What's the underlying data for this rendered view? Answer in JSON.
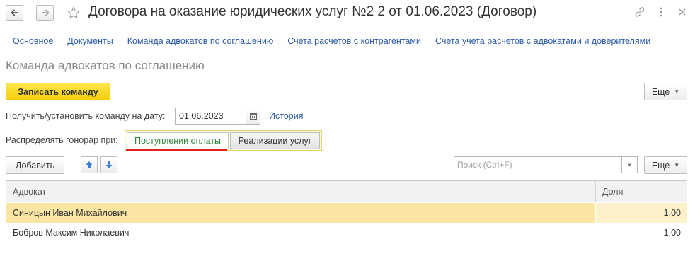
{
  "window": {
    "title": "Договора на оказание юридических услуг №2 2 от 01.06.2023 (Договор)"
  },
  "nav_links": [
    "Основное",
    "Документы",
    "Команда адвокатов по соглашению",
    "Счета расчетов с контрагентами",
    "Счета учета расчетов с адвокатами и доверителями"
  ],
  "section": {
    "title": "Команда адвокатов по соглашению"
  },
  "toolbar": {
    "write_team_label": "Записать команду",
    "more_label": "Еще"
  },
  "date_row": {
    "label": "Получить/установить команду на дату:",
    "value": "01.06.2023",
    "history_link": "История"
  },
  "distribute": {
    "label": "Распределять гонорар при:",
    "option_payment": "Поступлении оплаты",
    "option_sale": "Реализации услуг",
    "selected": "Поступлении оплаты"
  },
  "table_toolbar": {
    "add_label": "Добавить",
    "search_placeholder": "Поиск (Ctrl+F)",
    "clear_label": "×",
    "more_label": "Еще"
  },
  "table": {
    "columns": [
      "Адвокат",
      "Доля"
    ],
    "rows": [
      {
        "lawyer": "Синицын Иван Михайлович",
        "share": "1,00",
        "selected": true
      },
      {
        "lawyer": "Бобров Максим Николаевич",
        "share": "1,00",
        "selected": false
      }
    ]
  },
  "colors": {
    "accent_yellow": "#f5cd0a",
    "link_blue": "#2a5aa8",
    "selected_row": "#fbe5a2",
    "active_underline": "#e3201b",
    "active_text": "#2e8b3a"
  }
}
